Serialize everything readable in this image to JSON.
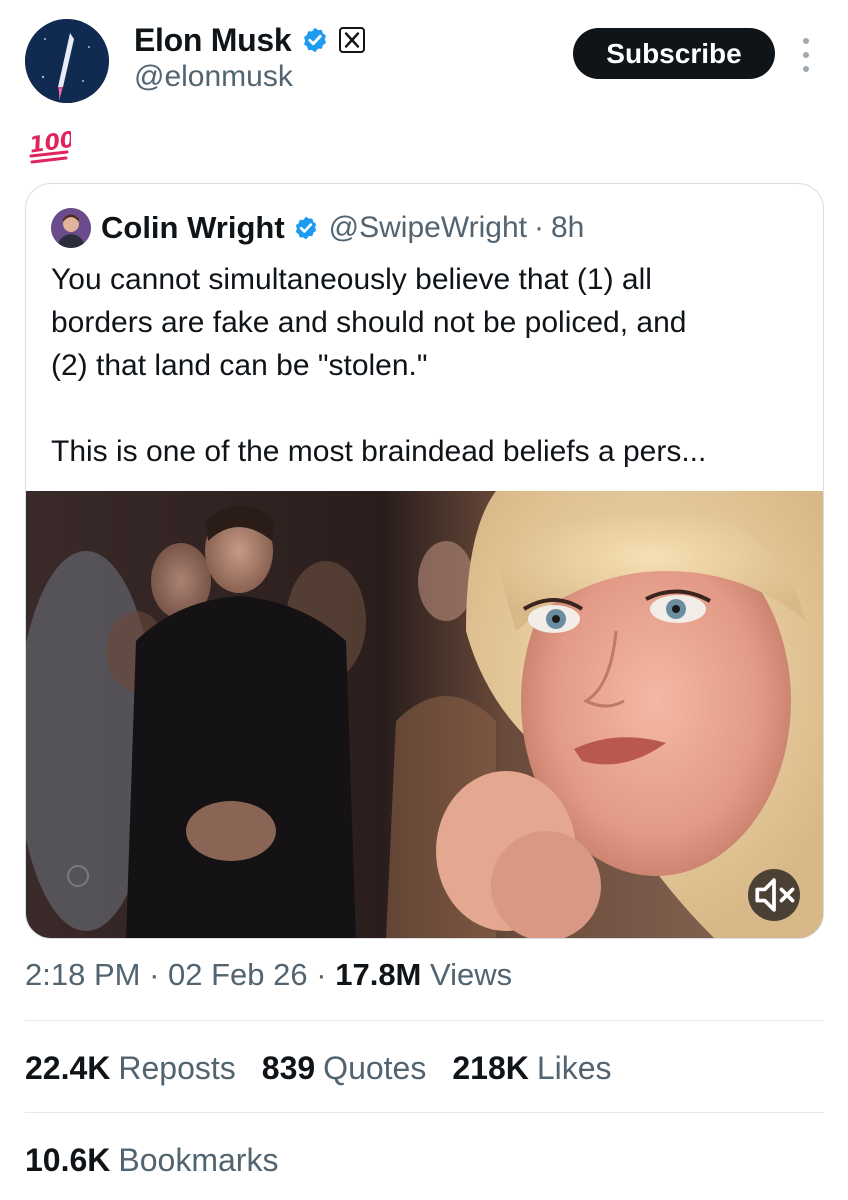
{
  "post": {
    "author_name": "Elon Musk",
    "author_handle": "@elonmusk",
    "subscribe_label": "Subscribe",
    "body_emoji": "100",
    "verified_color": "#1d9bf0"
  },
  "quoted_post": {
    "author_name": "Colin Wright",
    "author_handle": "@SwipeWright",
    "separator": "·",
    "time": "8h",
    "text": "You cannot simultaneously believe that (1) all\nborders are fake and should not be policed, and\n(2) that land can be \"stolen.\"\n\nThis is one of the most braindead beliefs a pers...",
    "media_icon": "mute-icon"
  },
  "meta": {
    "time": "2:18 PM",
    "separator": "·",
    "date": "02 Feb 26",
    "views_count": "17.8M",
    "views_label": "Views"
  },
  "stats": {
    "reposts_count": "22.4K",
    "reposts_label": "Reposts",
    "quotes_count": "839",
    "quotes_label": "Quotes",
    "likes_count": "218K",
    "likes_label": "Likes",
    "bookmarks_count": "10.6K",
    "bookmarks_label": "Bookmarks"
  }
}
